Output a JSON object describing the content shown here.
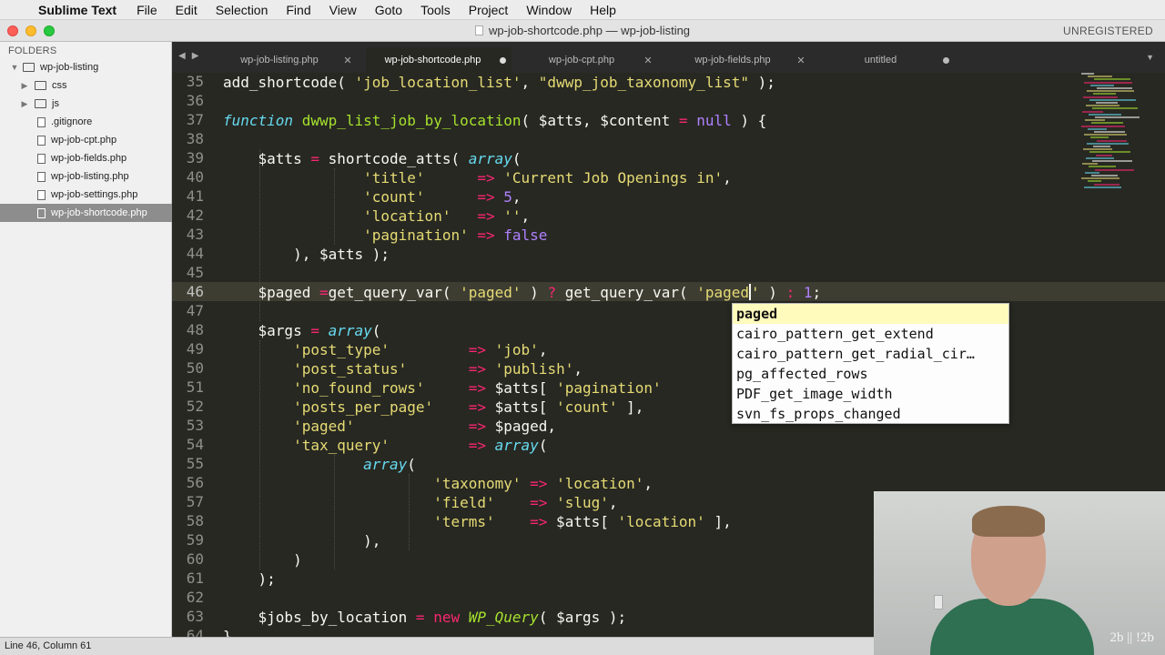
{
  "menubar": {
    "app": "Sublime Text",
    "items": [
      "File",
      "Edit",
      "Selection",
      "Find",
      "View",
      "Goto",
      "Tools",
      "Project",
      "Window",
      "Help"
    ]
  },
  "window": {
    "title": "wp-job-shortcode.php — wp-job-listing",
    "registration": "UNREGISTERED"
  },
  "sidebar": {
    "header": "FOLDERS",
    "root": "wp-job-listing",
    "folders": [
      "css",
      "js"
    ],
    "files": [
      ".gitignore",
      "wp-job-cpt.php",
      "wp-job-fields.php",
      "wp-job-listing.php",
      "wp-job-settings.php",
      "wp-job-shortcode.php"
    ],
    "selected_file": "wp-job-shortcode.php"
  },
  "tabs": [
    {
      "label": "wp-job-listing.php",
      "state": "close"
    },
    {
      "label": "wp-job-shortcode.php",
      "state": "dirty",
      "active": true
    },
    {
      "label": "wp-job-cpt.php",
      "state": "close"
    },
    {
      "label": "wp-job-fields.php",
      "state": "close"
    },
    {
      "label": "untitled",
      "state": "dirty"
    }
  ],
  "editor": {
    "line_numbers": [
      "35",
      "36",
      "37",
      "38",
      "39",
      "40",
      "41",
      "42",
      "43",
      "44",
      "45",
      "46",
      "47",
      "48",
      "49",
      "50",
      "51",
      "52",
      "53",
      "54",
      "55",
      "56",
      "57",
      "58",
      "59",
      "60",
      "61",
      "62",
      "63",
      "64"
    ],
    "current_line": "46"
  },
  "autocomplete": {
    "items": [
      "paged",
      "cairo_pattern_get_extend",
      "cairo_pattern_get_radial_cir…",
      "pg_affected_rows",
      "PDF_get_image_width",
      "svn_fs_props_changed"
    ],
    "selected_index": 0
  },
  "statusbar": {
    "text": "Line 46, Column 61"
  },
  "webcam": {
    "caption": "2b || !2b"
  },
  "colors": {
    "editor_bg": "#272822",
    "keyword": "#f92672",
    "string": "#e6db74",
    "function": "#a6e22e",
    "storage": "#66d9ef",
    "number": "#ae81ff"
  }
}
